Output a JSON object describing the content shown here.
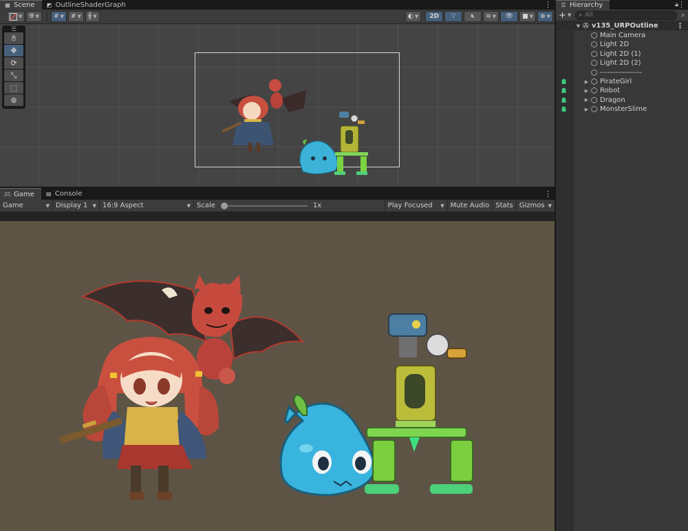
{
  "scene_tabs": {
    "scene": {
      "icon": "scene-grid-icon",
      "label": "Scene"
    },
    "shadergraph": {
      "icon": "shader-graph-icon",
      "label": "OutlineShaderGraph"
    }
  },
  "scene_toolbar": {
    "right_2d_label": "2D"
  },
  "bottom_tabs": {
    "game": {
      "icon": "gamepad-icon",
      "label": "Game"
    },
    "console": {
      "icon": "console-icon",
      "label": "Console"
    }
  },
  "game_toolbar": {
    "mode": "Game",
    "display": "Display 1",
    "aspect": "16:9 Aspect",
    "scale_label": "Scale",
    "scale_value": "1x",
    "play_focused": "Play Focused",
    "mute_audio": "Mute Audio",
    "stats": "Stats",
    "gizmos": "Gizmos"
  },
  "hierarchy": {
    "title": "Hierarchy",
    "search_placeholder": "All",
    "scene_name": "v135_URPOutline",
    "items": [
      {
        "label": "Main Camera",
        "expandable": false,
        "visible_icon": false
      },
      {
        "label": "Light 2D",
        "expandable": false,
        "visible_icon": false
      },
      {
        "label": "Light 2D (1)",
        "expandable": false,
        "visible_icon": false
      },
      {
        "label": "Light 2D (2)",
        "expandable": false,
        "visible_icon": false
      },
      {
        "label": "-----------------",
        "expandable": false,
        "visible_icon": false
      },
      {
        "label": "PirateGirl",
        "expandable": true,
        "visible_icon": true
      },
      {
        "label": "Robot",
        "expandable": true,
        "visible_icon": true
      },
      {
        "label": "Dragon",
        "expandable": true,
        "visible_icon": true
      },
      {
        "label": "MonsterSlime",
        "expandable": true,
        "visible_icon": true
      }
    ]
  },
  "colors": {
    "game_bg": "#5d5446",
    "scene_bg": "#444444",
    "accent": "#46607c",
    "visibility_icon": "#3ec97a"
  }
}
